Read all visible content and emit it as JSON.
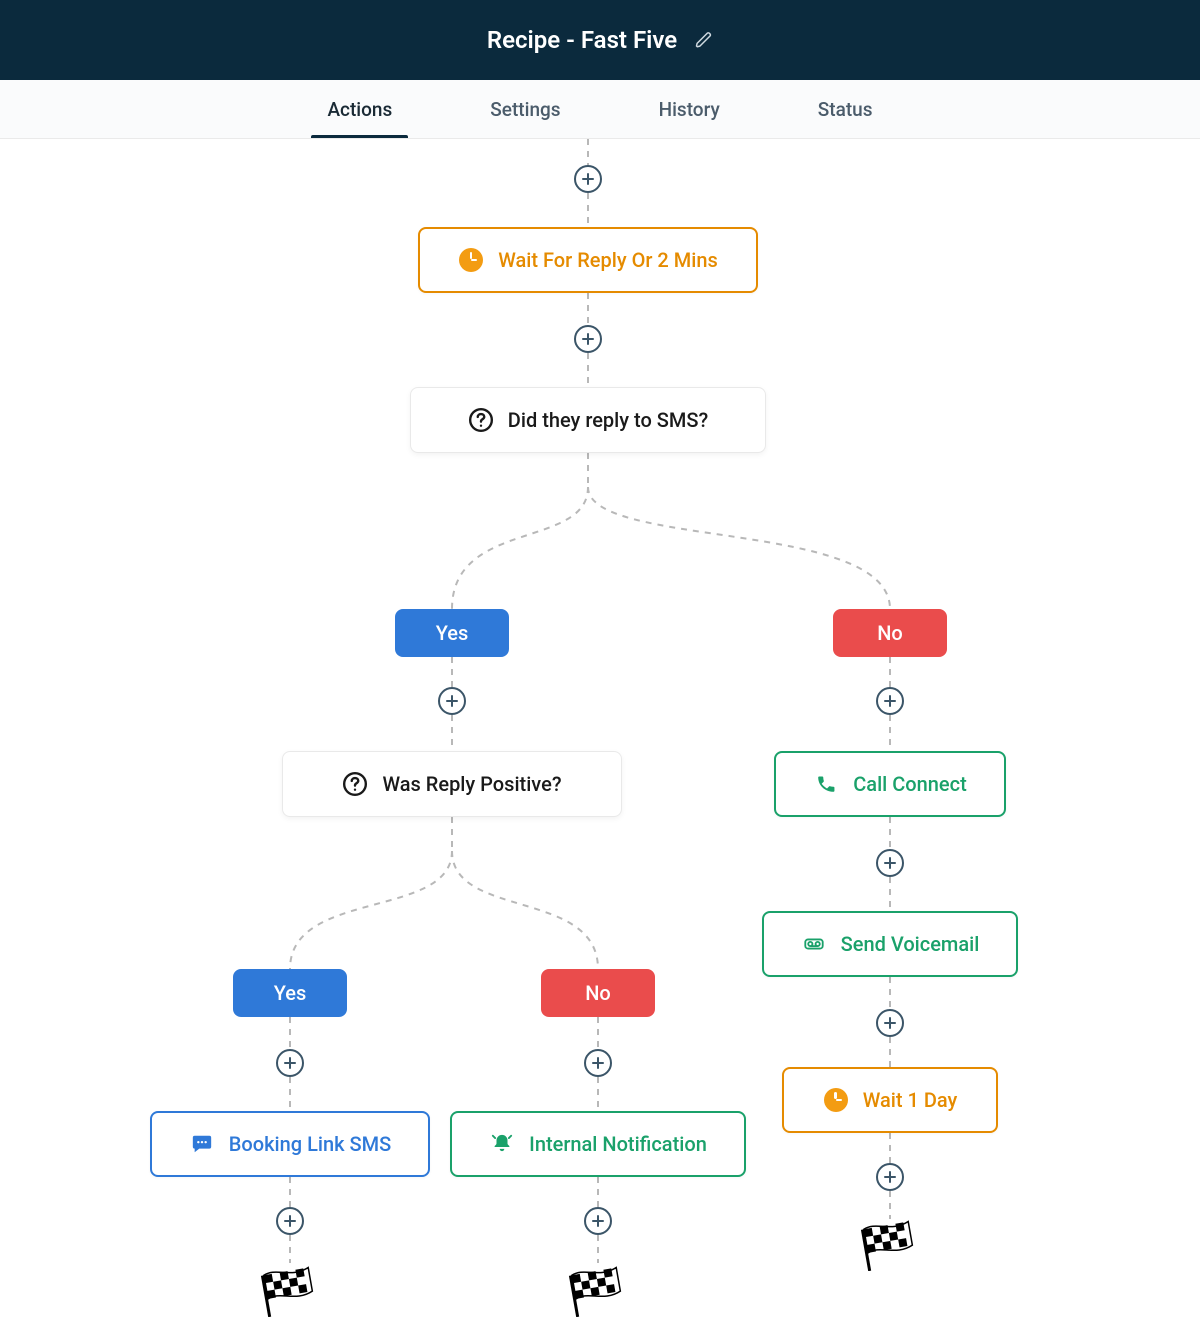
{
  "header": {
    "title": "Recipe - Fast Five"
  },
  "tabs": [
    {
      "id": "actions",
      "label": "Actions",
      "active": true
    },
    {
      "id": "settings",
      "label": "Settings",
      "active": false
    },
    {
      "id": "history",
      "label": "History",
      "active": false
    },
    {
      "id": "status",
      "label": "Status",
      "active": false
    }
  ],
  "nodes": {
    "wait1": {
      "label": "Wait For Reply Or 2 Mins"
    },
    "decision1": {
      "label": "Did they reply to SMS?"
    },
    "yes1": {
      "label": "Yes"
    },
    "no1": {
      "label": "No"
    },
    "decision2": {
      "label": "Was Reply Positive?"
    },
    "callConnect": {
      "label": "Call Connect"
    },
    "yes2": {
      "label": "Yes"
    },
    "no2": {
      "label": "No"
    },
    "sendVoicemail": {
      "label": "Send Voicemail"
    },
    "wait2": {
      "label": "Wait 1 Day"
    },
    "bookingSMS": {
      "label": "Booking Link SMS"
    },
    "internalNotification": {
      "label": "Internal Notification"
    }
  }
}
